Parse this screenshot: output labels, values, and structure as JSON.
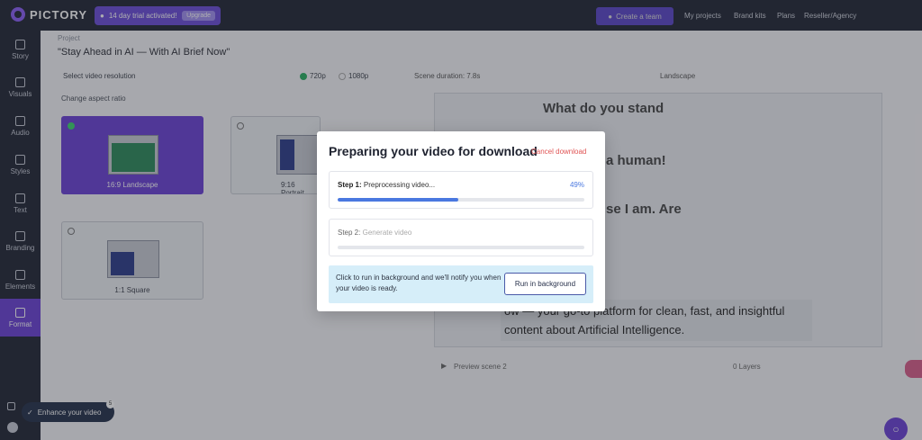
{
  "app": {
    "logo_text": "PICTORY",
    "trial_text": "14 day trial activated!",
    "upgrade_label": "Upgrade",
    "create_team_label": "Create a team",
    "top_links": [
      "My projects",
      "Brand kits",
      "Plans",
      "Reseller/Agency"
    ]
  },
  "sidebar": {
    "items": [
      {
        "label": "Story",
        "icon": "story-icon"
      },
      {
        "label": "Visuals",
        "icon": "visuals-icon"
      },
      {
        "label": "Audio",
        "icon": "audio-icon"
      },
      {
        "label": "Styles",
        "icon": "styles-icon"
      },
      {
        "label": "Text",
        "icon": "text-icon"
      },
      {
        "label": "Branding",
        "icon": "branding-icon"
      },
      {
        "label": "Elements",
        "icon": "elements-icon"
      },
      {
        "label": "Format",
        "icon": "format-icon",
        "active": true
      }
    ]
  },
  "project": {
    "label": "Project",
    "title": "\"Stay Ahead in AI — With AI Brief Now\""
  },
  "format": {
    "resolution_label": "Select video resolution",
    "res_720": "720p",
    "res_1080": "1080p",
    "aspect_label": "Change aspect ratio",
    "cards": {
      "landscape": "16:9 Landscape",
      "portrait": "9:16 Portrait",
      "square": "1:1 Square"
    }
  },
  "preview": {
    "scene_duration": "Scene duration: 7.8s",
    "orientation": "Landscape",
    "canvas_line1": "What do you stand",
    "canvas_line2": "a human!",
    "canvas_line3": "se I am. Are",
    "caption": "ow — your go-to platform for clean, fast, and insightful content about Artificial Intelligence.",
    "preview_scene": "Preview scene 2",
    "layers": "0 Layers"
  },
  "enhance": {
    "label": "Enhance your video",
    "badge": "5"
  },
  "modal": {
    "title": "Preparing your video for download",
    "cancel_label": "Cancel download",
    "step1_prefix": "Step 1:",
    "step1_text": "Preprocessing video...",
    "step1_percent_label": "49%",
    "step1_progress": 0.49,
    "step2_prefix": "Step 2:",
    "step2_text": "Generate video",
    "step2_progress": 0,
    "background_text": "Click to run in background and we'll notify you when your video is ready.",
    "background_button": "Run in background"
  },
  "colors": {
    "brand": "#6a3fd6",
    "progress": "#4a78e0",
    "cancel": "#e05454",
    "info_bg": "#d6eef9"
  }
}
